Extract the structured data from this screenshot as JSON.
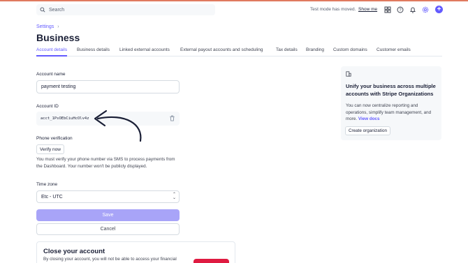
{
  "topbar": {
    "search_placeholder": "Search",
    "test_mode_text": "Test mode has moved.",
    "show_me_link": "Show me",
    "accent_color": "#635bff"
  },
  "breadcrumb": {
    "settings": "Settings",
    "separator": "›"
  },
  "page": {
    "title": "Business"
  },
  "tabs": [
    {
      "label": "Account details",
      "active": true
    },
    {
      "label": "Business details",
      "active": false
    },
    {
      "label": "Linked external accounts",
      "active": false
    },
    {
      "label": "External payout accounts and scheduling",
      "active": false
    },
    {
      "label": "Tax details",
      "active": false
    },
    {
      "label": "Branding",
      "active": false
    },
    {
      "label": "Custom domains",
      "active": false
    },
    {
      "label": "Customer emails",
      "active": false
    }
  ],
  "form": {
    "account_name_label": "Account name",
    "account_name_value": "payment testing",
    "account_id_label": "Account ID",
    "account_id_value": "acct_1PsOEbCiuHcOlv4z",
    "phone_label": "Phone verification",
    "verify_button": "Verify now",
    "phone_helper": "You must verify your phone number via SMS to process payments from the Dashboard. Your number won't be publicly displayed.",
    "timezone_label": "Time zone",
    "timezone_value": "Etc - UTC",
    "save_button": "Save",
    "cancel_button": "Cancel"
  },
  "close_account": {
    "title": "Close your account",
    "description": "By closing your account, you will not be able to access your financial"
  },
  "promo": {
    "title": "Unify your business across multiple accounts with Stripe Organizations",
    "body": "You can now centralize reporting and operations, simplify team management, and more.",
    "link": "View docs",
    "button": "Create organization"
  },
  "icons": [
    "search-icon",
    "apps-icon",
    "help-icon",
    "bell-icon",
    "gear-icon",
    "plus-icon",
    "trash-icon",
    "organization-icon",
    "arrow-annotation"
  ]
}
